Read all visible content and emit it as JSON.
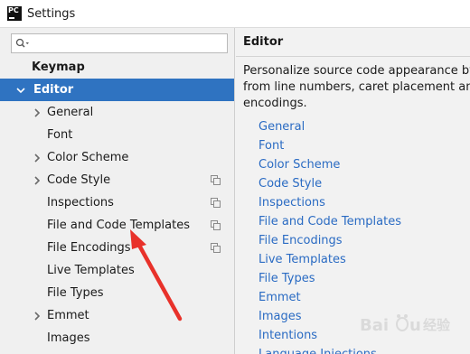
{
  "window": {
    "app_icon_text": "PC",
    "title": "Settings"
  },
  "sidebar": {
    "search": {
      "value": "",
      "placeholder": ""
    },
    "items": [
      {
        "label": "Keymap",
        "bold": true,
        "selected": false,
        "has_arrow": false,
        "has_copy_icon": false
      },
      {
        "label": "Editor",
        "bold": true,
        "selected": true,
        "has_arrow": true,
        "expanded": true,
        "has_copy_icon": false
      },
      {
        "label": "General",
        "bold": false,
        "selected": false,
        "has_arrow": true,
        "expanded": false,
        "has_copy_icon": false
      },
      {
        "label": "Font",
        "bold": false,
        "selected": false,
        "has_arrow": false,
        "has_copy_icon": false
      },
      {
        "label": "Color Scheme",
        "bold": false,
        "selected": false,
        "has_arrow": true,
        "expanded": false,
        "has_copy_icon": false
      },
      {
        "label": "Code Style",
        "bold": false,
        "selected": false,
        "has_arrow": true,
        "expanded": false,
        "has_copy_icon": true
      },
      {
        "label": "Inspections",
        "bold": false,
        "selected": false,
        "has_arrow": false,
        "has_copy_icon": true
      },
      {
        "label": "File and Code Templates",
        "bold": false,
        "selected": false,
        "has_arrow": false,
        "has_copy_icon": true
      },
      {
        "label": "File Encodings",
        "bold": false,
        "selected": false,
        "has_arrow": false,
        "has_copy_icon": true
      },
      {
        "label": "Live Templates",
        "bold": false,
        "selected": false,
        "has_arrow": false,
        "has_copy_icon": false
      },
      {
        "label": "File Types",
        "bold": false,
        "selected": false,
        "has_arrow": false,
        "has_copy_icon": false
      },
      {
        "label": "Emmet",
        "bold": false,
        "selected": false,
        "has_arrow": true,
        "expanded": false,
        "has_copy_icon": false
      },
      {
        "label": "Images",
        "bold": false,
        "selected": false,
        "has_arrow": false,
        "has_copy_icon": false
      }
    ]
  },
  "content": {
    "title": "Editor",
    "description_lines": [
      "Personalize source code appearance by ch",
      "from line numbers, caret placement and tab",
      "encodings."
    ],
    "links": [
      "General",
      "Font",
      "Color Scheme",
      "Code Style",
      "Inspections",
      "File and Code Templates",
      "File Encodings",
      "Live Templates",
      "File Types",
      "Emmet",
      "Images",
      "Intentions",
      "Language Injections"
    ]
  },
  "annotation": {
    "color": "#e8312a",
    "target": "File and Code Templates"
  },
  "watermark": {
    "text": "Baidu 经验"
  },
  "colors": {
    "selection": "#2f73c1",
    "link": "#2a6bc3",
    "sidebar_bg": "#f0f0f0",
    "content_bg": "#f2f2f2"
  }
}
